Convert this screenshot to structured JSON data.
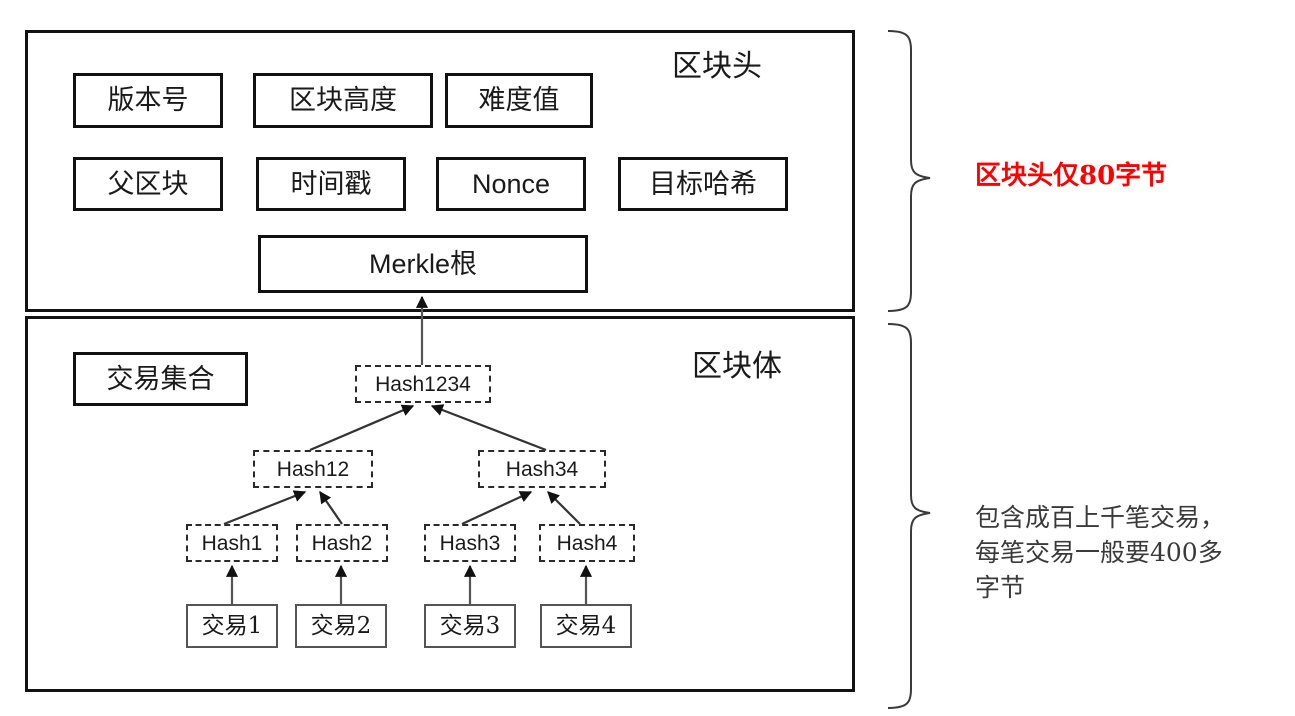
{
  "diagram": {
    "title": "Bitcoin block structure with Merkle tree",
    "sections": {
      "header": {
        "caption": "区块头",
        "fields": [
          {
            "id": "version",
            "label": "版本号"
          },
          {
            "id": "height",
            "label": "区块高度"
          },
          {
            "id": "difficulty",
            "label": "难度值"
          },
          {
            "id": "parent",
            "label": "父区块"
          },
          {
            "id": "timestamp",
            "label": "时间戳"
          },
          {
            "id": "nonce",
            "label": "Nonce"
          },
          {
            "id": "target",
            "label": "目标哈希"
          },
          {
            "id": "merkle",
            "label": "Merkle根"
          }
        ]
      },
      "body": {
        "caption": "区块体",
        "txset_label": "交易集合",
        "hashes": {
          "root": "Hash1234",
          "left": "Hash12",
          "right": "Hash34",
          "leaf1": "Hash1",
          "leaf2": "Hash2",
          "leaf3": "Hash3",
          "leaf4": "Hash4"
        },
        "transactions": [
          {
            "id": "tx1",
            "label": "交易1"
          },
          {
            "id": "tx2",
            "label": "交易2"
          },
          {
            "id": "tx3",
            "label": "交易3"
          },
          {
            "id": "tx4",
            "label": "交易4"
          }
        ]
      }
    },
    "annotations": {
      "header_note": "区块头仅80字节",
      "body_note": "包含成百上千笔交易，\n每笔交易一般要400多\n字节"
    },
    "colors": {
      "header_note_color": "#ff0000",
      "body_note_color": "#3a3a3a",
      "stroke": "#111111",
      "background": "#ffffff"
    }
  }
}
